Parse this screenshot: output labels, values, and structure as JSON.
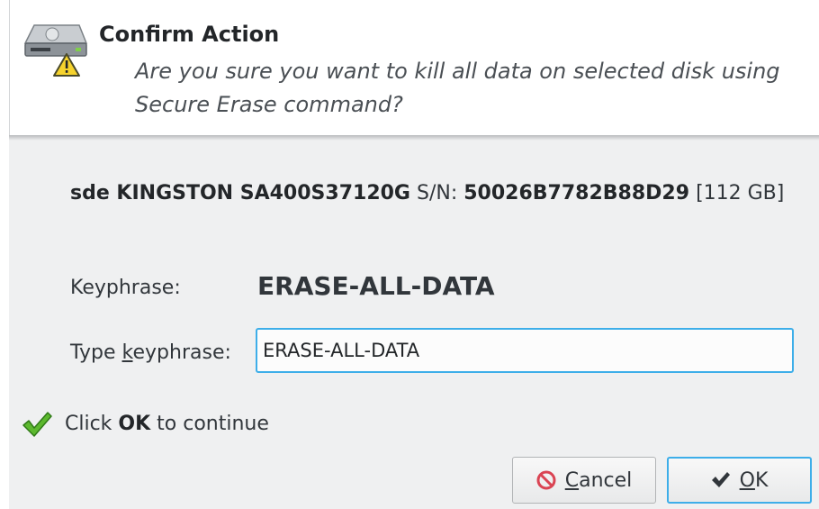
{
  "dialog": {
    "title": "Confirm Action",
    "question": "Are you sure you want to kill all data on selected disk using Secure Erase command?"
  },
  "disk": {
    "device": "sde KINGSTON SA400S37120G",
    "serial_label": "S/N:",
    "serial": "50026B7782B88D29",
    "size": "[112 GB]"
  },
  "keyphrase": {
    "label": "Keyphrase:",
    "value": "ERASE-ALL-DATA",
    "input_label_prefix": "Type ",
    "input_label_mnemonic": "k",
    "input_label_suffix": "eyphrase:",
    "input_value": "ERASE-ALL-DATA"
  },
  "status": {
    "prefix": "Click ",
    "bold": "OK",
    "suffix": " to continue"
  },
  "buttons": {
    "cancel_mnemonic": "C",
    "cancel_rest": "ancel",
    "ok_mnemonic": "O",
    "ok_rest": "K"
  },
  "icons": {
    "dialog_icon": "drive-harddisk-warning-icon",
    "status_icon": "green-checkmark-icon",
    "cancel_icon": "cancel-icon",
    "ok_icon": "checkmark-icon"
  },
  "colors": {
    "focus": "#3daee9",
    "warning": "#f6d32d",
    "success": "#4caf50",
    "cancel_red": "#da4453"
  }
}
